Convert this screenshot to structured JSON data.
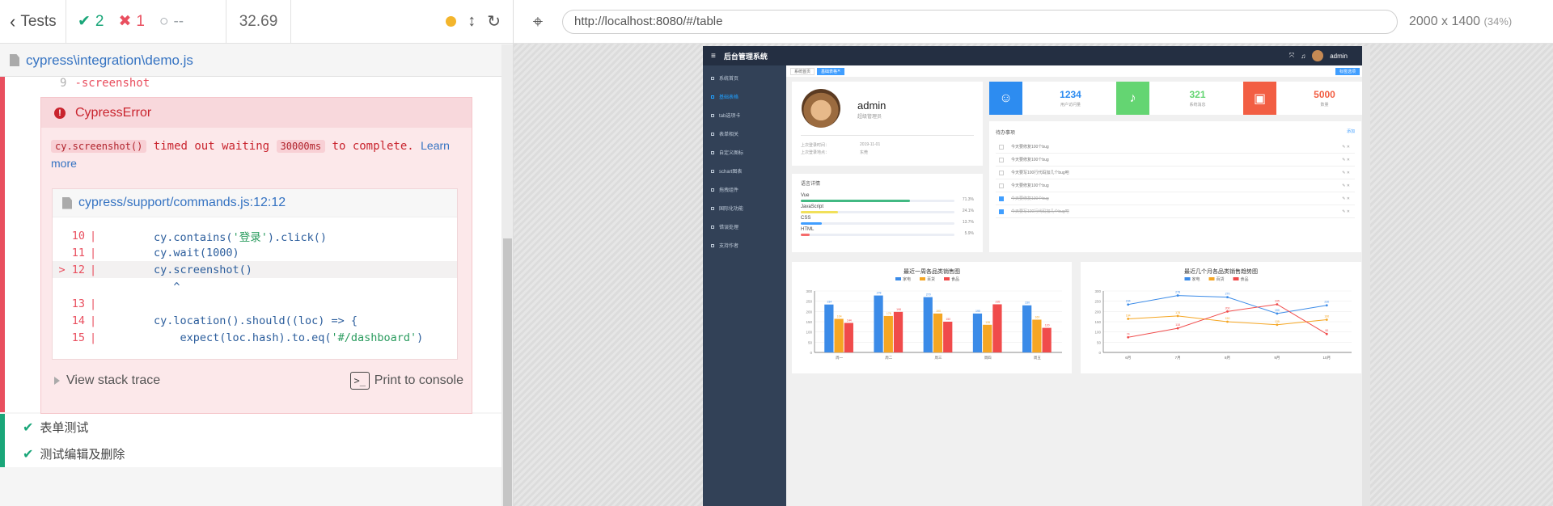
{
  "reporter": {
    "tests_label": "Tests",
    "passed": "2",
    "failed": "1",
    "pending": "--",
    "duration": "32.69",
    "spec_path": "cypress\\integration\\demo.js",
    "cmd_number": "9",
    "cmd_text": "-screenshot",
    "error_name": "CypressError",
    "error_msg": {
      "code1": "cy.screenshot()",
      "mid1": " timed out waiting ",
      "code2": "30000ms",
      "mid2": " to complete. ",
      "learn": "Learn",
      "more": "more"
    },
    "code_file": "cypress/support/commands.js:12:12",
    "code_lines": [
      {
        "n": "10",
        "pre": "        cy.contains(",
        "str": "'登录'",
        "post": ").click()",
        "hl": false
      },
      {
        "n": "11",
        "pre": "        cy.wait(1000)",
        "str": "",
        "post": "",
        "hl": false
      },
      {
        "n": "> 12",
        "pre": "        cy.screenshot()",
        "str": "",
        "post": "",
        "hl": true
      },
      {
        "n": "",
        "pre": "           ^",
        "str": "",
        "post": "",
        "hl": false
      },
      {
        "n": "13",
        "pre": "",
        "str": "",
        "post": "",
        "hl": false
      },
      {
        "n": "14",
        "pre": "        cy.location().should((loc) => {",
        "str": "",
        "post": "",
        "hl": false
      },
      {
        "n": "15",
        "pre": "            expect(loc.hash).to.eq(",
        "str": "'#/dashboard'",
        "post": ")",
        "hl": false
      }
    ],
    "view_stack": "View stack trace",
    "print_console": "Print to console",
    "tests": [
      "表单测试",
      "测试编辑及删除"
    ]
  },
  "browser": {
    "url": "http://localhost:8080/#/table",
    "viewport": "2000 x 1400",
    "scale": "(34%)"
  },
  "aut": {
    "system_title": "后台管理系统",
    "user_short": "admin",
    "sidebar": [
      "系统首页",
      "基础表格",
      "tab选项卡",
      "表单相关",
      "自定义图标",
      "schart图表",
      "拖拽组件",
      "国际化功能",
      "错误处理",
      "支持作者"
    ],
    "sidebar_active": 1,
    "tags": [
      "系统首页",
      "基础表格"
    ],
    "tag_ops": "标签选项",
    "user": {
      "name": "admin",
      "role": "超级管理员",
      "last_login_label": "上次登录时间：",
      "last_login": "2019-11-01",
      "last_place_label": "上次登录地点：",
      "last_place": "东莞"
    },
    "lang_title": "语言详情",
    "langs": [
      {
        "name": "Vue",
        "pct": "71.3%",
        "value": 71.3,
        "color": "#42b983"
      },
      {
        "name": "JavaScript",
        "pct": "24.1%",
        "value": 24.1,
        "color": "#f1e05a"
      },
      {
        "name": "CSS",
        "pct": "13.7%",
        "value": 13.7,
        "color": "#409eff"
      },
      {
        "name": "HTML",
        "pct": "5.9%",
        "value": 5.9,
        "color": "#f56c6c"
      }
    ],
    "stats": [
      {
        "num": "1234",
        "label": "用户访问量",
        "color": "#2d8cf0",
        "icon": "user-icon"
      },
      {
        "num": "321",
        "label": "系统消息",
        "color": "#64d572",
        "icon": "bell-icon"
      },
      {
        "num": "5000",
        "label": "数量",
        "color": "#f25e43",
        "icon": "bag-icon"
      }
    ],
    "todo_title": "待办事项",
    "todo_add": "添加",
    "todos": [
      {
        "text": "今天要修复100个bug",
        "done": false
      },
      {
        "text": "今天要修复100个bug",
        "done": false
      },
      {
        "text": "今天要写100行代码加几个bug吧",
        "done": false
      },
      {
        "text": "今天要修复100个bug",
        "done": false
      },
      {
        "text": "今天要修复100个bug",
        "done": true
      },
      {
        "text": "今天要写100行代码加几个bug吧",
        "done": true
      }
    ],
    "todo_ops": "✎ ✕"
  },
  "chart_data": [
    {
      "type": "bar",
      "title": "最近一周各品类销售图",
      "categories": [
        "周一",
        "周二",
        "周三",
        "周四",
        "周五"
      ],
      "series": [
        {
          "name": "家电",
          "values": [
            234,
            278,
            270,
            190,
            230
          ],
          "color": "#3b8be8"
        },
        {
          "name": "百货",
          "values": [
            164,
            178,
            190,
            135,
            160
          ],
          "color": "#f5a623"
        },
        {
          "name": "食品",
          "values": [
            144,
            198,
            150,
            235,
            120
          ],
          "color": "#f04b4b"
        }
      ],
      "ylim": [
        0,
        300
      ],
      "yticks": [
        "300",
        "250",
        "200",
        "150",
        "100",
        "50",
        "0"
      ]
    },
    {
      "type": "line",
      "title": "最近几个月各品类销售趋势图",
      "categories": [
        "6月",
        "7月",
        "8月",
        "9月",
        "10月"
      ],
      "series": [
        {
          "name": "家电",
          "values": [
            234,
            278,
            270,
            190,
            230
          ],
          "color": "#3b8be8"
        },
        {
          "name": "百货",
          "values": [
            164,
            178,
            150,
            135,
            160
          ],
          "color": "#f5a623"
        },
        {
          "name": "食品",
          "values": [
            74,
            118,
            200,
            235,
            90
          ],
          "color": "#f04b4b"
        }
      ],
      "ylim": [
        0,
        300
      ],
      "yticks": [
        "300",
        "250",
        "200",
        "150",
        "100",
        "50",
        "0"
      ]
    }
  ]
}
